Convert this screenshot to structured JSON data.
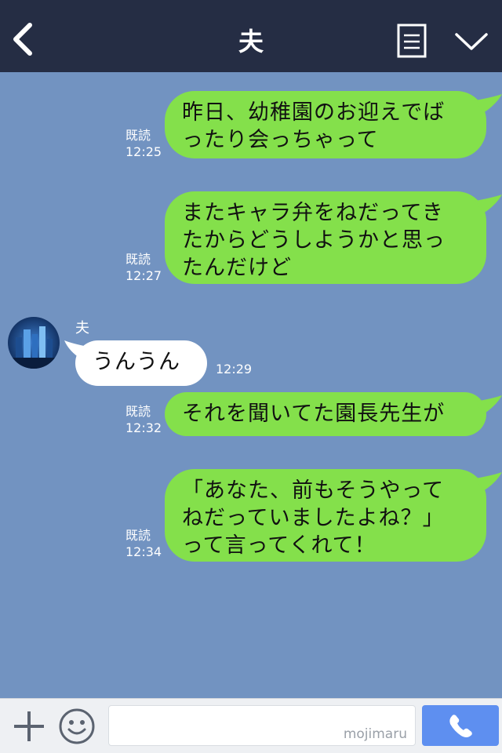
{
  "header": {
    "title": "夫",
    "back_icon": "chevron-left-icon",
    "menu_icon": "list-icon",
    "collapse_icon": "chevron-down-icon"
  },
  "messages": [
    {
      "direction": "outgoing",
      "lines": [
        "昨日、幼稚園のお迎えでば",
        "ったり会っちゃって"
      ],
      "read": "既読",
      "time": "12:25"
    },
    {
      "direction": "outgoing",
      "lines": [
        "またキャラ弁をねだってき",
        "たからどうしようかと思っ",
        "たんだけど"
      ],
      "read": "既読",
      "time": "12:27"
    },
    {
      "direction": "incoming",
      "sender": "夫",
      "lines": [
        "うんうん"
      ],
      "time": "12:29"
    },
    {
      "direction": "outgoing",
      "lines": [
        "それを聞いてた園長先生が"
      ],
      "read": "既読",
      "time": "12:32"
    },
    {
      "direction": "outgoing",
      "lines": [
        "「あなた、前もそうやって",
        "ねだっていましたよね？」",
        "って言ってくれて！"
      ],
      "read": "既読",
      "time": "12:34"
    }
  ],
  "footer": {
    "watermark": "mojimaru",
    "plus_icon": "plus-icon",
    "emoji_icon": "smiley-icon",
    "call_icon": "phone-icon"
  },
  "colors": {
    "header_bg": "#252d44",
    "chat_bg": "#7293c1",
    "outgoing_bubble": "#84e04b",
    "incoming_bubble": "#ffffff",
    "call_button": "#5e8ff0"
  }
}
